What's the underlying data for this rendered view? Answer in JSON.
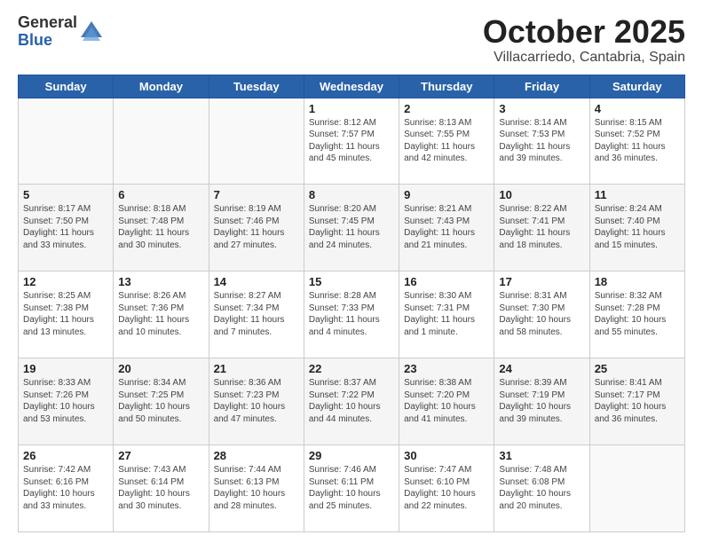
{
  "header": {
    "logo_general": "General",
    "logo_blue": "Blue",
    "month": "October 2025",
    "location": "Villacarriedo, Cantabria, Spain"
  },
  "weekdays": [
    "Sunday",
    "Monday",
    "Tuesday",
    "Wednesday",
    "Thursday",
    "Friday",
    "Saturday"
  ],
  "weeks": [
    [
      {
        "day": "",
        "info": ""
      },
      {
        "day": "",
        "info": ""
      },
      {
        "day": "",
        "info": ""
      },
      {
        "day": "1",
        "info": "Sunrise: 8:12 AM\nSunset: 7:57 PM\nDaylight: 11 hours\nand 45 minutes."
      },
      {
        "day": "2",
        "info": "Sunrise: 8:13 AM\nSunset: 7:55 PM\nDaylight: 11 hours\nand 42 minutes."
      },
      {
        "day": "3",
        "info": "Sunrise: 8:14 AM\nSunset: 7:53 PM\nDaylight: 11 hours\nand 39 minutes."
      },
      {
        "day": "4",
        "info": "Sunrise: 8:15 AM\nSunset: 7:52 PM\nDaylight: 11 hours\nand 36 minutes."
      }
    ],
    [
      {
        "day": "5",
        "info": "Sunrise: 8:17 AM\nSunset: 7:50 PM\nDaylight: 11 hours\nand 33 minutes."
      },
      {
        "day": "6",
        "info": "Sunrise: 8:18 AM\nSunset: 7:48 PM\nDaylight: 11 hours\nand 30 minutes."
      },
      {
        "day": "7",
        "info": "Sunrise: 8:19 AM\nSunset: 7:46 PM\nDaylight: 11 hours\nand 27 minutes."
      },
      {
        "day": "8",
        "info": "Sunrise: 8:20 AM\nSunset: 7:45 PM\nDaylight: 11 hours\nand 24 minutes."
      },
      {
        "day": "9",
        "info": "Sunrise: 8:21 AM\nSunset: 7:43 PM\nDaylight: 11 hours\nand 21 minutes."
      },
      {
        "day": "10",
        "info": "Sunrise: 8:22 AM\nSunset: 7:41 PM\nDaylight: 11 hours\nand 18 minutes."
      },
      {
        "day": "11",
        "info": "Sunrise: 8:24 AM\nSunset: 7:40 PM\nDaylight: 11 hours\nand 15 minutes."
      }
    ],
    [
      {
        "day": "12",
        "info": "Sunrise: 8:25 AM\nSunset: 7:38 PM\nDaylight: 11 hours\nand 13 minutes."
      },
      {
        "day": "13",
        "info": "Sunrise: 8:26 AM\nSunset: 7:36 PM\nDaylight: 11 hours\nand 10 minutes."
      },
      {
        "day": "14",
        "info": "Sunrise: 8:27 AM\nSunset: 7:34 PM\nDaylight: 11 hours\nand 7 minutes."
      },
      {
        "day": "15",
        "info": "Sunrise: 8:28 AM\nSunset: 7:33 PM\nDaylight: 11 hours\nand 4 minutes."
      },
      {
        "day": "16",
        "info": "Sunrise: 8:30 AM\nSunset: 7:31 PM\nDaylight: 11 hours\nand 1 minute."
      },
      {
        "day": "17",
        "info": "Sunrise: 8:31 AM\nSunset: 7:30 PM\nDaylight: 10 hours\nand 58 minutes."
      },
      {
        "day": "18",
        "info": "Sunrise: 8:32 AM\nSunset: 7:28 PM\nDaylight: 10 hours\nand 55 minutes."
      }
    ],
    [
      {
        "day": "19",
        "info": "Sunrise: 8:33 AM\nSunset: 7:26 PM\nDaylight: 10 hours\nand 53 minutes."
      },
      {
        "day": "20",
        "info": "Sunrise: 8:34 AM\nSunset: 7:25 PM\nDaylight: 10 hours\nand 50 minutes."
      },
      {
        "day": "21",
        "info": "Sunrise: 8:36 AM\nSunset: 7:23 PM\nDaylight: 10 hours\nand 47 minutes."
      },
      {
        "day": "22",
        "info": "Sunrise: 8:37 AM\nSunset: 7:22 PM\nDaylight: 10 hours\nand 44 minutes."
      },
      {
        "day": "23",
        "info": "Sunrise: 8:38 AM\nSunset: 7:20 PM\nDaylight: 10 hours\nand 41 minutes."
      },
      {
        "day": "24",
        "info": "Sunrise: 8:39 AM\nSunset: 7:19 PM\nDaylight: 10 hours\nand 39 minutes."
      },
      {
        "day": "25",
        "info": "Sunrise: 8:41 AM\nSunset: 7:17 PM\nDaylight: 10 hours\nand 36 minutes."
      }
    ],
    [
      {
        "day": "26",
        "info": "Sunrise: 7:42 AM\nSunset: 6:16 PM\nDaylight: 10 hours\nand 33 minutes."
      },
      {
        "day": "27",
        "info": "Sunrise: 7:43 AM\nSunset: 6:14 PM\nDaylight: 10 hours\nand 30 minutes."
      },
      {
        "day": "28",
        "info": "Sunrise: 7:44 AM\nSunset: 6:13 PM\nDaylight: 10 hours\nand 28 minutes."
      },
      {
        "day": "29",
        "info": "Sunrise: 7:46 AM\nSunset: 6:11 PM\nDaylight: 10 hours\nand 25 minutes."
      },
      {
        "day": "30",
        "info": "Sunrise: 7:47 AM\nSunset: 6:10 PM\nDaylight: 10 hours\nand 22 minutes."
      },
      {
        "day": "31",
        "info": "Sunrise: 7:48 AM\nSunset: 6:08 PM\nDaylight: 10 hours\nand 20 minutes."
      },
      {
        "day": "",
        "info": ""
      }
    ]
  ]
}
